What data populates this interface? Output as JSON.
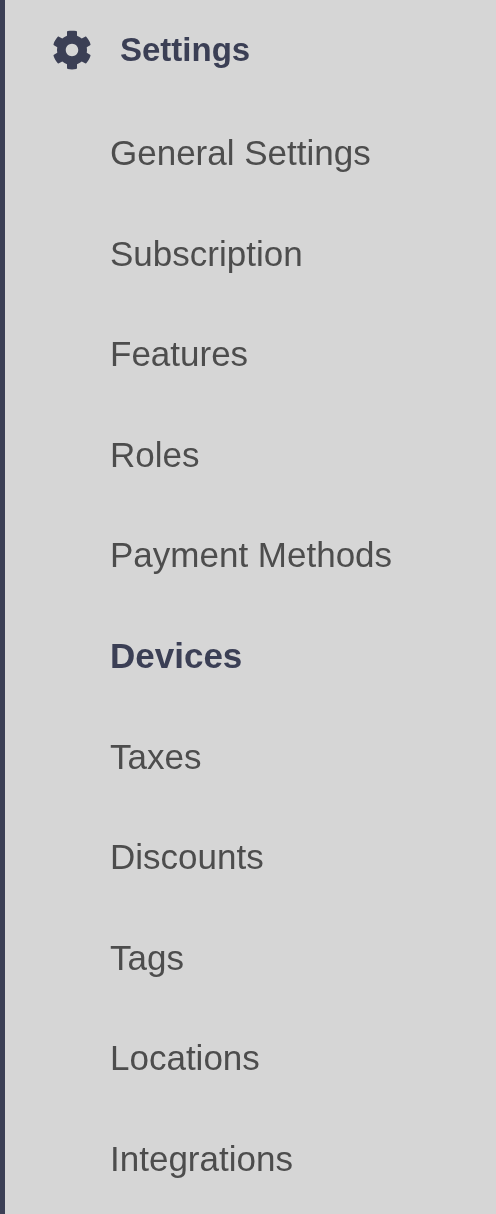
{
  "sidebar": {
    "section": {
      "title": "Settings"
    },
    "items": [
      {
        "label": "General Settings",
        "selected": false
      },
      {
        "label": "Subscription",
        "selected": false
      },
      {
        "label": "Features",
        "selected": false
      },
      {
        "label": "Roles",
        "selected": false
      },
      {
        "label": "Payment Methods",
        "selected": false
      },
      {
        "label": "Devices",
        "selected": true
      },
      {
        "label": "Taxes",
        "selected": false
      },
      {
        "label": "Discounts",
        "selected": false
      },
      {
        "label": "Tags",
        "selected": false
      },
      {
        "label": "Locations",
        "selected": false
      },
      {
        "label": "Integrations",
        "selected": false
      }
    ]
  }
}
